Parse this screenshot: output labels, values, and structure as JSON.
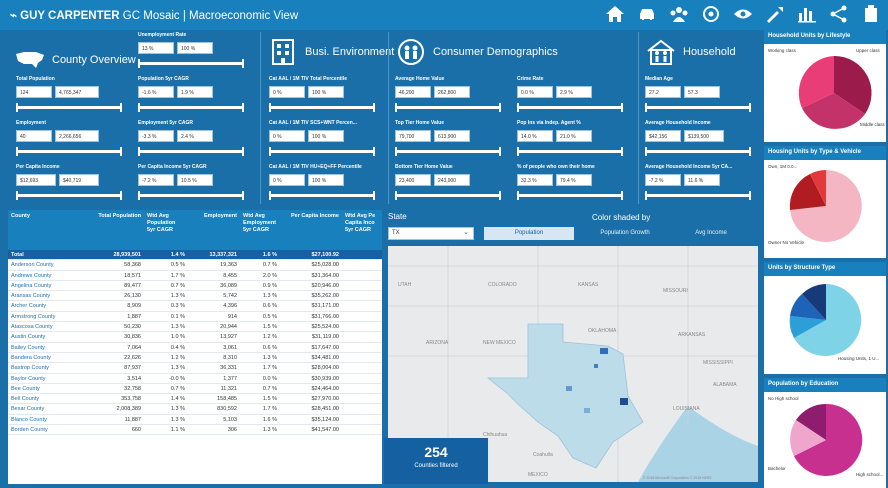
{
  "header": {
    "brand": "GUY CARPENTER",
    "app": "GC Mosaic | Macroeconomic View",
    "nav_icons": [
      "home-icon",
      "car-icon",
      "group-icon",
      "target-icon",
      "eye-icon",
      "tools-icon",
      "bar-chart-icon",
      "share-icon",
      "info-icon"
    ]
  },
  "sections": {
    "county": {
      "title": "County Overview",
      "unemp": {
        "label": "Unemployment Rate",
        "v1": "13 %",
        "v2": "100 %"
      },
      "pop": {
        "label": "Total Population",
        "v1": "124",
        "v2": "4,765,347"
      },
      "pop_cagr": {
        "label": "Population 5yr CAGR",
        "v1": "-1.6 %",
        "v2": "1.9 %"
      },
      "emp": {
        "label": "Employment",
        "v1": "40",
        "v2": "2,266,656"
      },
      "emp_cagr": {
        "label": "Employment 5yr CAGR",
        "v1": "-3.3 %",
        "v2": "2.4 %"
      },
      "pci": {
        "label": "Per Capita Income",
        "v1": "$12,693",
        "v2": "$40,719"
      },
      "pci_cagr": {
        "label": "Per Capita Income 5yr CAGR",
        "v1": "-7.2 %",
        "v2": "10.5 %"
      }
    },
    "business": {
      "title": "Busi. Environment",
      "m1": {
        "label": "Cat AAL / 1M TIV Total Percentile",
        "v1": "0 %",
        "v2": "100 %"
      },
      "m2": {
        "label": "Cat AAL / 1M TIV SCS+WNT Percen...",
        "v1": "0 %",
        "v2": "100 %"
      },
      "m3": {
        "label": "Cat AAL / 1M TIV HU+EQ+FF Percentile",
        "v1": "0 %",
        "v2": "100 %"
      }
    },
    "consumer": {
      "title": "Consumer Demographics",
      "home": {
        "label": "Average Home Value",
        "v1": "46,200",
        "v2": "262,800"
      },
      "crime": {
        "label": "Crime Rate",
        "v1": "0.0 %",
        "v2": "2.9 %"
      },
      "top": {
        "label": "Top Tier Home Value",
        "v1": "79,700",
        "v2": "613,900"
      },
      "agent": {
        "label": "Pop Ins via Indep. Agent %",
        "v1": "14.0 %",
        "v2": "21.0 %"
      },
      "bottom": {
        "label": "Bottom Tier Home Value",
        "v1": "23,400",
        "v2": "243,900"
      },
      "own": {
        "label": "% of people who own their home",
        "v1": "32.3 %",
        "v2": "79.4 %"
      }
    },
    "household": {
      "title": "Household",
      "age": {
        "label": "Median Age",
        "v1": "27.2",
        "v2": "57.3"
      },
      "income": {
        "label": "Average Household Income",
        "v1": "$42,156",
        "v2": "$139,500"
      },
      "income_cagr": {
        "label": "Average Household Income 5yr CA...",
        "v1": "-7.2 %",
        "v2": "11.6 %"
      }
    }
  },
  "table": {
    "headers": [
      "County",
      "Total Population",
      "Wtd Avg Population 5yr CAGR",
      "Employment",
      "Wtd Avg Employment 5yr CAGR",
      "Per Capita Income",
      "Wtd Avg Pe Capita Inco 5yr CAGR"
    ],
    "total": [
      "Total",
      "28,939,501",
      "1.4 %",
      "13,337,321",
      "1.6 %",
      "$27,100.92",
      ""
    ],
    "rows": [
      [
        "Anderson County",
        "58,368",
        "0.5 %",
        "19,363",
        "0.7 %",
        "$25,028.00",
        ""
      ],
      [
        "Andrews County",
        "18,571",
        "1.7 %",
        "8,455",
        "2.0 %",
        "$31,364.00",
        ""
      ],
      [
        "Angelina County",
        "89,477",
        "0.7 %",
        "36,089",
        "0.9 %",
        "$20,946.00",
        ""
      ],
      [
        "Aransas County",
        "26,130",
        "1.3 %",
        "5,742",
        "1.3 %",
        "$35,262.00",
        ""
      ],
      [
        "Archer County",
        "8,909",
        "0.3 %",
        "4,396",
        "0.6 %",
        "$31,171.00",
        ""
      ],
      [
        "Armstrong County",
        "1,887",
        "0.1 %",
        "914",
        "0.5 %",
        "$31,766.00",
        ""
      ],
      [
        "Atascosa County",
        "50,230",
        "1.3 %",
        "20,944",
        "1.5 %",
        "$25,524.00",
        ""
      ],
      [
        "Austin County",
        "30,836",
        "1.0 %",
        "13,927",
        "1.2 %",
        "$31,119.00",
        ""
      ],
      [
        "Bailey County",
        "7,064",
        "0.4 %",
        "3,061",
        "0.6 %",
        "$17,647.00",
        ""
      ],
      [
        "Bandera County",
        "22,626",
        "1.2 %",
        "8,310",
        "1.3 %",
        "$34,481.00",
        ""
      ],
      [
        "Bastrop County",
        "87,937",
        "1.3 %",
        "36,331",
        "1.7 %",
        "$28,004.00",
        ""
      ],
      [
        "Baylor County",
        "3,514",
        "-0.0 %",
        "1,377",
        "0.0 %",
        "$30,939.00",
        ""
      ],
      [
        "Bee County",
        "32,758",
        "0.7 %",
        "11,321",
        "0.7 %",
        "$24,464.00",
        ""
      ],
      [
        "Bell County",
        "353,758",
        "1.4 %",
        "158,485",
        "1.5 %",
        "$27,970.00",
        ""
      ],
      [
        "Bexar County",
        "2,008,389",
        "1.3 %",
        "830,592",
        "1.7 %",
        "$28,451.00",
        ""
      ],
      [
        "Blanco County",
        "11,887",
        "1.3 %",
        "5,103",
        "1.6 %",
        "$35,124.00",
        ""
      ],
      [
        "Borden County",
        "660",
        "1.1 %",
        "306",
        "1.3 %",
        "$41,547.00",
        ""
      ]
    ]
  },
  "map": {
    "state_label": "State",
    "state_value": "TX",
    "color_title": "Color shaded by",
    "options": [
      "Population",
      "Population Growth",
      "Avg Income"
    ],
    "selected": "Population",
    "count": "254",
    "count_label": "Counties filtered",
    "labels": [
      "UTAH",
      "COLORADO",
      "KANSAS",
      "MISSOURI",
      "ARIZONA",
      "NEW MEXICO",
      "OKLAHOMA",
      "ARKANSAS",
      "MISSISSIPPI",
      "ALABAMA",
      "LOUISIANA",
      "Chihuahua",
      "Coahuila",
      "MEXICO"
    ],
    "attribution": "© 2018 Microsoft Corporation © 2018 HERE"
  },
  "pies": [
    {
      "title": "Household Units by Lifestyle",
      "labels": [
        "Working class",
        "Upper class",
        "Middle class"
      ]
    },
    {
      "title": "Housing Units by Type & Vehicle",
      "labels": [
        "Own, 1M 0.0...",
        "Owner No Vehicle"
      ]
    },
    {
      "title": "Units by Structure Type",
      "labels": [
        "Housing Units, 1 U..."
      ]
    },
    {
      "title": "Population by Education",
      "labels": [
        "No High school",
        "Bachelor",
        "High school..."
      ]
    }
  ]
}
